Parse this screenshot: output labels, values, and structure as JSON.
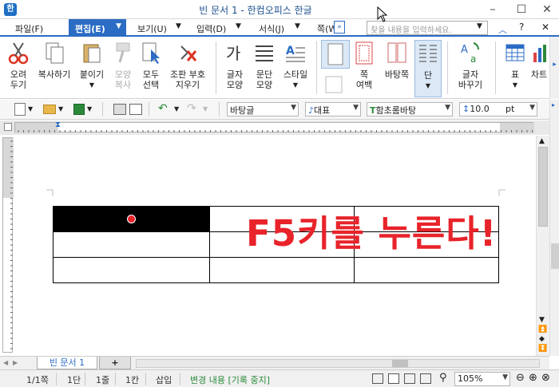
{
  "window": {
    "title": "빈 문서 1 - 한컴오피스 한글",
    "logo": "한"
  },
  "menu": {
    "items": [
      "파일(F)",
      "편집(E)",
      "보기(U)",
      "입력(D)",
      "서식(J)",
      "쪽(W)"
    ],
    "search_placeholder": "찾을 내용을 입력하세요."
  },
  "ribbon": {
    "cut": [
      "오려",
      "두기"
    ],
    "copy": "복사하기",
    "paste": "붙이기",
    "format_copy": [
      "모양",
      "복사"
    ],
    "select_all": [
      "모두",
      "선택"
    ],
    "combine": [
      "조판 부호",
      "지우기"
    ],
    "char_shape": [
      "글자",
      "모양"
    ],
    "para_shape": [
      "문단",
      "모양"
    ],
    "style": "스타일",
    "page": [
      "쪽",
      "여백"
    ],
    "page_border": "바탕쪽",
    "column": "단",
    "replace": [
      "글자",
      "바꾸기"
    ],
    "table": "표",
    "chart": "차트"
  },
  "toolbar": {
    "style_combo": "바탕글",
    "lang_combo": "대표",
    "font_combo": "함초롬바탕",
    "size_combo": "10.0",
    "unit": "pt"
  },
  "document": {
    "overlay_text": "F5키를 누른다!",
    "colors": {
      "overlay": "#e8232a",
      "selected_cell": "#000000",
      "accent": "#2b6cc4"
    }
  },
  "tabs": {
    "doc_tab": "빈 문서 1",
    "add_tab": "+"
  },
  "status": {
    "page": "1/1쪽",
    "section": "1단",
    "line": "1줄",
    "column": "1칸",
    "mode": "삽입",
    "track": "변경 내용 [기록 중지]",
    "zoom": "105%"
  }
}
